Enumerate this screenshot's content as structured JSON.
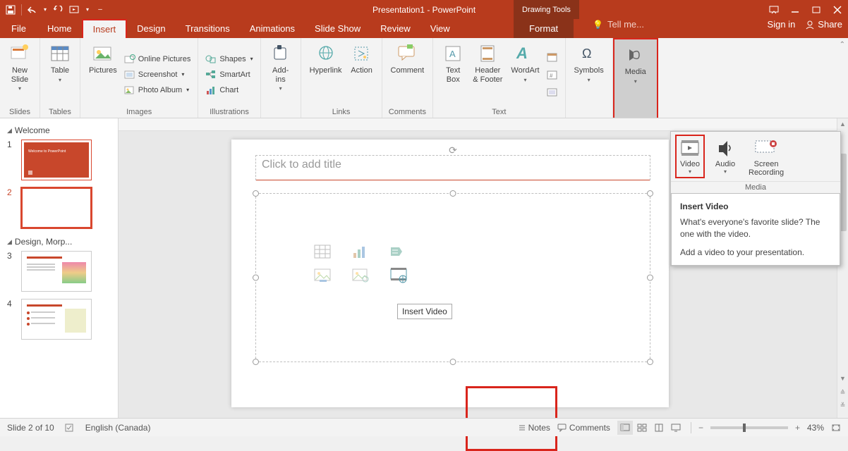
{
  "window": {
    "title": "Presentation1 - PowerPoint",
    "drawing_tools": "Drawing Tools"
  },
  "tabs": {
    "file": "File",
    "home": "Home",
    "insert": "Insert",
    "design": "Design",
    "transitions": "Transitions",
    "animations": "Animations",
    "slideshow": "Slide Show",
    "review": "Review",
    "view": "View",
    "format": "Format",
    "tellme": "Tell me...",
    "signin": "Sign in",
    "share": "Share"
  },
  "ribbon": {
    "slides": {
      "new_slide": "New\nSlide",
      "group": "Slides"
    },
    "tables": {
      "table": "Table",
      "group": "Tables"
    },
    "images": {
      "pictures": "Pictures",
      "online_pictures": "Online Pictures",
      "screenshot": "Screenshot",
      "photo_album": "Photo Album",
      "group": "Images"
    },
    "illustrations": {
      "shapes": "Shapes",
      "smartart": "SmartArt",
      "chart": "Chart",
      "group": "Illustrations"
    },
    "addins": {
      "addins": "Add-\nins",
      "group": ""
    },
    "links": {
      "hyperlink": "Hyperlink",
      "action": "Action",
      "group": "Links"
    },
    "comments": {
      "comment": "Comment",
      "group": "Comments"
    },
    "text": {
      "textbox": "Text\nBox",
      "header_footer": "Header\n& Footer",
      "wordart": "WordArt",
      "group": "Text"
    },
    "symbols": {
      "symbols": "Symbols",
      "group": ""
    },
    "media": {
      "media": "Media",
      "group": ""
    }
  },
  "media_popup": {
    "video": "Video",
    "audio": "Audio",
    "screen_recording": "Screen\nRecording",
    "group": "Media",
    "tooltip_title": "Insert Video",
    "tooltip_line1": "What's everyone's favorite slide? The one with the video.",
    "tooltip_line2": "Add a video to your presentation."
  },
  "sections": {
    "welcome": "Welcome",
    "design": "Design, Morp..."
  },
  "thumbs": {
    "n1": "1",
    "n2": "2",
    "n3": "3",
    "n4": "4"
  },
  "slide": {
    "title_placeholder": "Click to add title",
    "insert_video_tip": "Insert Video"
  },
  "status": {
    "slide_count": "Slide 2 of 10",
    "language": "English (Canada)",
    "notes": "Notes",
    "comments": "Comments",
    "zoom": "43%"
  }
}
